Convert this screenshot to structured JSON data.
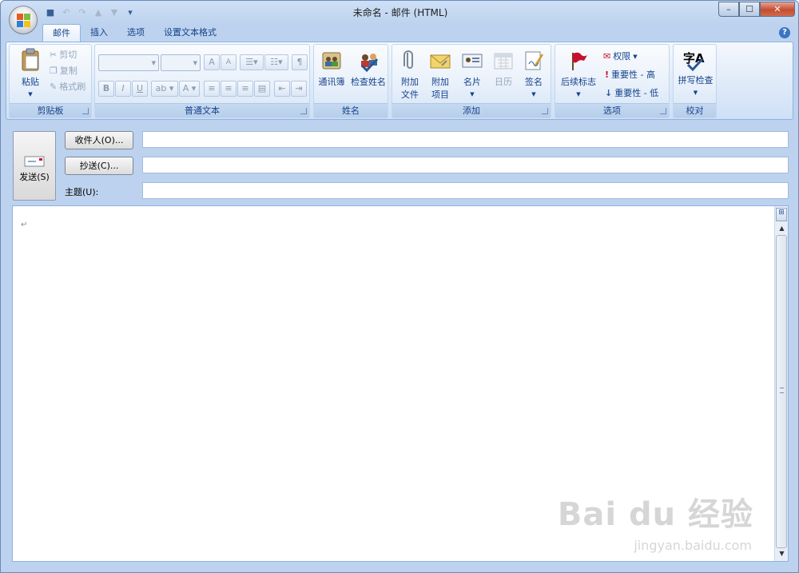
{
  "window": {
    "title": "未命名 - 邮件 (HTML)",
    "min_glyph": "–",
    "max_glyph": "☐",
    "close_glyph": "✕"
  },
  "qat": {
    "save_glyph": "■",
    "undo_glyph": "↶",
    "redo_glyph": "↷",
    "up_glyph": "▲",
    "down_glyph": "▼",
    "customize_glyph": "▾"
  },
  "tabs": [
    {
      "label": "邮件"
    },
    {
      "label": "插入"
    },
    {
      "label": "选项"
    },
    {
      "label": "设置文本格式"
    }
  ],
  "help_glyph": "?",
  "ribbon": {
    "clipboard": {
      "label": "剪贴板",
      "paste": "粘贴",
      "cut": "剪切",
      "copy": "复制",
      "format_painter": "格式刷"
    },
    "basic_text": {
      "label": "普通文本",
      "grow_font": "A",
      "shrink_font": "A",
      "bold": "B",
      "italic": "I",
      "underline": "U",
      "highlight": "ab",
      "font_color": "A"
    },
    "names": {
      "label": "姓名",
      "address_book": "通讯簿",
      "check_names": "检查姓名"
    },
    "include": {
      "label": "添加",
      "attach_file_line1": "附加",
      "attach_file_line2": "文件",
      "attach_item_line1": "附加",
      "attach_item_line2": "项目",
      "business_card": "名片",
      "calendar": "日历",
      "signature": "签名"
    },
    "options": {
      "label": "选项",
      "follow_up": "后续标志",
      "permission": "权限",
      "importance_high": "重要性 - 高",
      "importance_low": "重要性 - 低"
    },
    "proofing": {
      "label": "校对",
      "spelling": "拼写检查",
      "icon_text": "字A"
    }
  },
  "form": {
    "send": "发送(S)",
    "to_button": "收件人(O)...",
    "cc_button": "抄送(C)...",
    "subject_label": "主题(U):",
    "to_value": "",
    "cc_value": "",
    "subject_value": ""
  },
  "body": {
    "paragraph_mark": "↵"
  },
  "watermark": {
    "brand": "Bai du 经验",
    "url": "jingyan.baidu.com"
  },
  "colors": {
    "accent": "#15428b",
    "ribbon_border": "#8db2e3",
    "flag": "#c8102e"
  }
}
